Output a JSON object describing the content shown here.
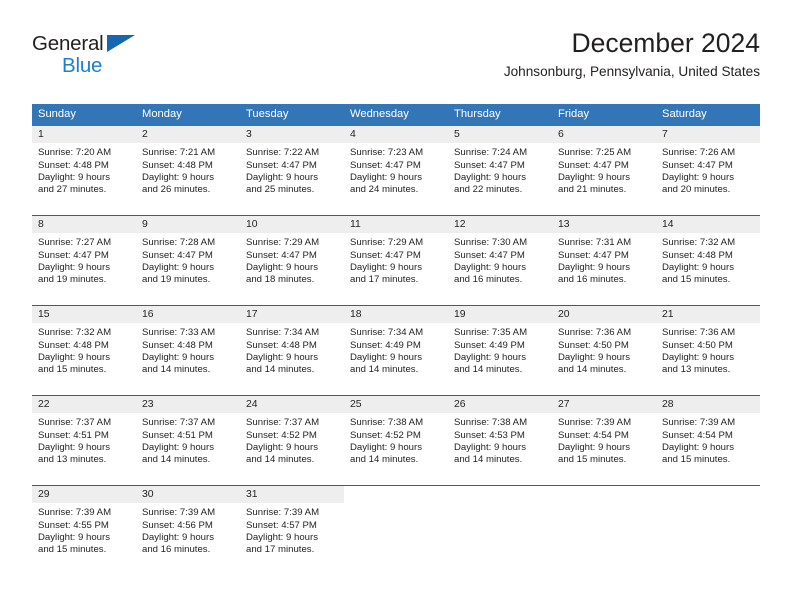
{
  "logo": {
    "line1": "General",
    "line2": "Blue",
    "triangle_color": "#1667b2",
    "line2_color": "#1b7fd4"
  },
  "header": {
    "title": "December 2024",
    "subtitle": "Johnsonburg, Pennsylvania, United States"
  },
  "theme": {
    "header_bg": "#3376b8",
    "week_divider": "#1667b2",
    "day_number_bg": "#eeeeee",
    "text": "#231f20"
  },
  "weekdays": [
    "Sunday",
    "Monday",
    "Tuesday",
    "Wednesday",
    "Thursday",
    "Friday",
    "Saturday"
  ],
  "weeks": [
    [
      {
        "day": "1",
        "sunrise": "Sunrise: 7:20 AM",
        "sunset": "Sunset: 4:48 PM",
        "daylight1": "Daylight: 9 hours",
        "daylight2": "and 27 minutes."
      },
      {
        "day": "2",
        "sunrise": "Sunrise: 7:21 AM",
        "sunset": "Sunset: 4:48 PM",
        "daylight1": "Daylight: 9 hours",
        "daylight2": "and 26 minutes."
      },
      {
        "day": "3",
        "sunrise": "Sunrise: 7:22 AM",
        "sunset": "Sunset: 4:47 PM",
        "daylight1": "Daylight: 9 hours",
        "daylight2": "and 25 minutes."
      },
      {
        "day": "4",
        "sunrise": "Sunrise: 7:23 AM",
        "sunset": "Sunset: 4:47 PM",
        "daylight1": "Daylight: 9 hours",
        "daylight2": "and 24 minutes."
      },
      {
        "day": "5",
        "sunrise": "Sunrise: 7:24 AM",
        "sunset": "Sunset: 4:47 PM",
        "daylight1": "Daylight: 9 hours",
        "daylight2": "and 22 minutes."
      },
      {
        "day": "6",
        "sunrise": "Sunrise: 7:25 AM",
        "sunset": "Sunset: 4:47 PM",
        "daylight1": "Daylight: 9 hours",
        "daylight2": "and 21 minutes."
      },
      {
        "day": "7",
        "sunrise": "Sunrise: 7:26 AM",
        "sunset": "Sunset: 4:47 PM",
        "daylight1": "Daylight: 9 hours",
        "daylight2": "and 20 minutes."
      }
    ],
    [
      {
        "day": "8",
        "sunrise": "Sunrise: 7:27 AM",
        "sunset": "Sunset: 4:47 PM",
        "daylight1": "Daylight: 9 hours",
        "daylight2": "and 19 minutes."
      },
      {
        "day": "9",
        "sunrise": "Sunrise: 7:28 AM",
        "sunset": "Sunset: 4:47 PM",
        "daylight1": "Daylight: 9 hours",
        "daylight2": "and 19 minutes."
      },
      {
        "day": "10",
        "sunrise": "Sunrise: 7:29 AM",
        "sunset": "Sunset: 4:47 PM",
        "daylight1": "Daylight: 9 hours",
        "daylight2": "and 18 minutes."
      },
      {
        "day": "11",
        "sunrise": "Sunrise: 7:29 AM",
        "sunset": "Sunset: 4:47 PM",
        "daylight1": "Daylight: 9 hours",
        "daylight2": "and 17 minutes."
      },
      {
        "day": "12",
        "sunrise": "Sunrise: 7:30 AM",
        "sunset": "Sunset: 4:47 PM",
        "daylight1": "Daylight: 9 hours",
        "daylight2": "and 16 minutes."
      },
      {
        "day": "13",
        "sunrise": "Sunrise: 7:31 AM",
        "sunset": "Sunset: 4:47 PM",
        "daylight1": "Daylight: 9 hours",
        "daylight2": "and 16 minutes."
      },
      {
        "day": "14",
        "sunrise": "Sunrise: 7:32 AM",
        "sunset": "Sunset: 4:48 PM",
        "daylight1": "Daylight: 9 hours",
        "daylight2": "and 15 minutes."
      }
    ],
    [
      {
        "day": "15",
        "sunrise": "Sunrise: 7:32 AM",
        "sunset": "Sunset: 4:48 PM",
        "daylight1": "Daylight: 9 hours",
        "daylight2": "and 15 minutes."
      },
      {
        "day": "16",
        "sunrise": "Sunrise: 7:33 AM",
        "sunset": "Sunset: 4:48 PM",
        "daylight1": "Daylight: 9 hours",
        "daylight2": "and 14 minutes."
      },
      {
        "day": "17",
        "sunrise": "Sunrise: 7:34 AM",
        "sunset": "Sunset: 4:48 PM",
        "daylight1": "Daylight: 9 hours",
        "daylight2": "and 14 minutes."
      },
      {
        "day": "18",
        "sunrise": "Sunrise: 7:34 AM",
        "sunset": "Sunset: 4:49 PM",
        "daylight1": "Daylight: 9 hours",
        "daylight2": "and 14 minutes."
      },
      {
        "day": "19",
        "sunrise": "Sunrise: 7:35 AM",
        "sunset": "Sunset: 4:49 PM",
        "daylight1": "Daylight: 9 hours",
        "daylight2": "and 14 minutes."
      },
      {
        "day": "20",
        "sunrise": "Sunrise: 7:36 AM",
        "sunset": "Sunset: 4:50 PM",
        "daylight1": "Daylight: 9 hours",
        "daylight2": "and 14 minutes."
      },
      {
        "day": "21",
        "sunrise": "Sunrise: 7:36 AM",
        "sunset": "Sunset: 4:50 PM",
        "daylight1": "Daylight: 9 hours",
        "daylight2": "and 13 minutes."
      }
    ],
    [
      {
        "day": "22",
        "sunrise": "Sunrise: 7:37 AM",
        "sunset": "Sunset: 4:51 PM",
        "daylight1": "Daylight: 9 hours",
        "daylight2": "and 13 minutes."
      },
      {
        "day": "23",
        "sunrise": "Sunrise: 7:37 AM",
        "sunset": "Sunset: 4:51 PM",
        "daylight1": "Daylight: 9 hours",
        "daylight2": "and 14 minutes."
      },
      {
        "day": "24",
        "sunrise": "Sunrise: 7:37 AM",
        "sunset": "Sunset: 4:52 PM",
        "daylight1": "Daylight: 9 hours",
        "daylight2": "and 14 minutes."
      },
      {
        "day": "25",
        "sunrise": "Sunrise: 7:38 AM",
        "sunset": "Sunset: 4:52 PM",
        "daylight1": "Daylight: 9 hours",
        "daylight2": "and 14 minutes."
      },
      {
        "day": "26",
        "sunrise": "Sunrise: 7:38 AM",
        "sunset": "Sunset: 4:53 PM",
        "daylight1": "Daylight: 9 hours",
        "daylight2": "and 14 minutes."
      },
      {
        "day": "27",
        "sunrise": "Sunrise: 7:39 AM",
        "sunset": "Sunset: 4:54 PM",
        "daylight1": "Daylight: 9 hours",
        "daylight2": "and 15 minutes."
      },
      {
        "day": "28",
        "sunrise": "Sunrise: 7:39 AM",
        "sunset": "Sunset: 4:54 PM",
        "daylight1": "Daylight: 9 hours",
        "daylight2": "and 15 minutes."
      }
    ],
    [
      {
        "day": "29",
        "sunrise": "Sunrise: 7:39 AM",
        "sunset": "Sunset: 4:55 PM",
        "daylight1": "Daylight: 9 hours",
        "daylight2": "and 15 minutes."
      },
      {
        "day": "30",
        "sunrise": "Sunrise: 7:39 AM",
        "sunset": "Sunset: 4:56 PM",
        "daylight1": "Daylight: 9 hours",
        "daylight2": "and 16 minutes."
      },
      {
        "day": "31",
        "sunrise": "Sunrise: 7:39 AM",
        "sunset": "Sunset: 4:57 PM",
        "daylight1": "Daylight: 9 hours",
        "daylight2": "and 17 minutes."
      },
      {
        "day": "",
        "sunrise": "",
        "sunset": "",
        "daylight1": "",
        "daylight2": ""
      },
      {
        "day": "",
        "sunrise": "",
        "sunset": "",
        "daylight1": "",
        "daylight2": ""
      },
      {
        "day": "",
        "sunrise": "",
        "sunset": "",
        "daylight1": "",
        "daylight2": ""
      },
      {
        "day": "",
        "sunrise": "",
        "sunset": "",
        "daylight1": "",
        "daylight2": ""
      }
    ]
  ]
}
